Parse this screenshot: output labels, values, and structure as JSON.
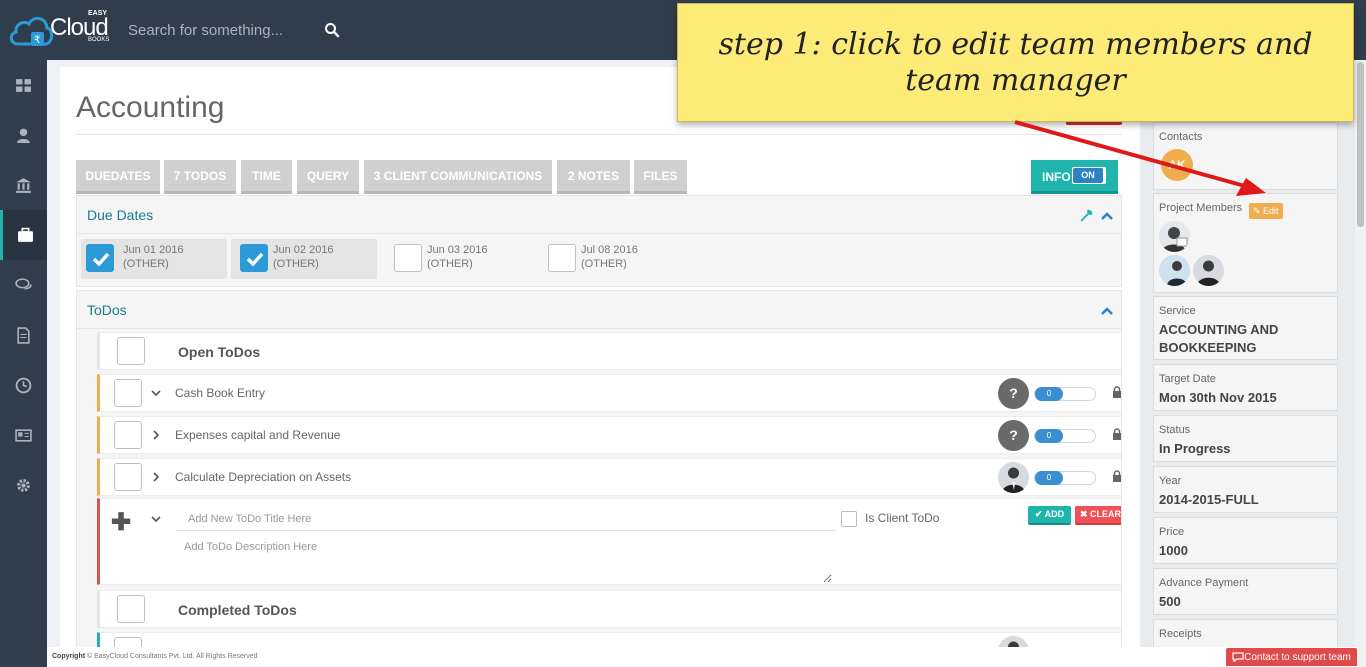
{
  "app": {
    "logo_main": "Cloud",
    "logo_top": "EASY",
    "logo_bottom": "BOOKS"
  },
  "search": {
    "placeholder": "Search for something..."
  },
  "sidebar": {
    "items": [
      {
        "icon": "dashboard-icon"
      },
      {
        "icon": "user-icon"
      },
      {
        "icon": "bank-icon"
      },
      {
        "icon": "briefcase-icon",
        "active": true
      },
      {
        "icon": "comments-icon"
      },
      {
        "icon": "document-icon"
      },
      {
        "icon": "clock-icon"
      },
      {
        "icon": "newspaper-icon"
      },
      {
        "icon": "gear-icon"
      }
    ]
  },
  "page": {
    "title": "Accounting"
  },
  "tabs": [
    {
      "label": "DUEDATES"
    },
    {
      "label": "7 TODOS"
    },
    {
      "label": "TIME"
    },
    {
      "label": "QUERY"
    },
    {
      "label": "3 CLIENT COMMUNICATIONS"
    },
    {
      "label": "2 NOTES"
    },
    {
      "label": "FILES"
    }
  ],
  "info_toggle": {
    "label": "INFO",
    "state": "ON"
  },
  "due_dates": {
    "title": "Due Dates",
    "items": [
      {
        "date": "Jun 01 2016",
        "type": "(OTHER)",
        "checked": true
      },
      {
        "date": "Jun 02 2016",
        "type": "(OTHER)",
        "checked": true
      },
      {
        "date": "Jun 03 2016",
        "type": "(OTHER)",
        "checked": false
      },
      {
        "date": "Jul 08 2016",
        "type": "(OTHER)",
        "checked": false
      }
    ]
  },
  "todos": {
    "title": "ToDos",
    "open_title": "Open ToDos",
    "completed_title": "Completed ToDos",
    "items": [
      {
        "title": "Cash Book Entry",
        "progress": 0,
        "assignee": "?"
      },
      {
        "title": "Expenses capital and Revenue",
        "progress": 0,
        "assignee": "?"
      },
      {
        "title": "Calculate Depreciation on Assets",
        "progress": 0,
        "assignee": "photo"
      }
    ],
    "progress_labels": [
      "0",
      "0",
      "0"
    ],
    "unknown_assignee": "?",
    "new_todo": {
      "title_placeholder": "Add New ToDo Title Here",
      "desc_placeholder": "Add ToDo Description Here",
      "client_label": "Is Client ToDo",
      "add_label": "✔ ADD",
      "clear_label": "✖ CLEAR"
    }
  },
  "info": {
    "contacts_label": "Contacts",
    "contact_initials": "AK",
    "members_label": "Project Members",
    "edit_label": "✎ Edit",
    "service_label": "Service",
    "service_value": "ACCOUNTING AND BOOKKEEPING",
    "target_label": "Target Date",
    "target_value": "Mon 30th Nov 2015",
    "status_label": "Status",
    "status_value": "In Progress",
    "year_label": "Year",
    "year_value": "2014-2015-FULL",
    "price_label": "Price",
    "price_value": "1000",
    "advance_label": "Advance Payment",
    "advance_value": "500",
    "receipts_label": "Receipts"
  },
  "footer": {
    "copyright_bold": "Copyright",
    "copyright_rest": " © EasyCloud Consultants Pvt. Ltd. All Rights Reserved",
    "support_label": "Contact to support team"
  },
  "callout": {
    "text": "step 1: click to edit team members and team manager"
  },
  "colors": {
    "sidebar_bg": "#2f3d4c",
    "accent": "#1fb5ad",
    "open_border": "#f0ad4e",
    "danger": "#d9534f",
    "callout_bg": "#fdeb77"
  }
}
